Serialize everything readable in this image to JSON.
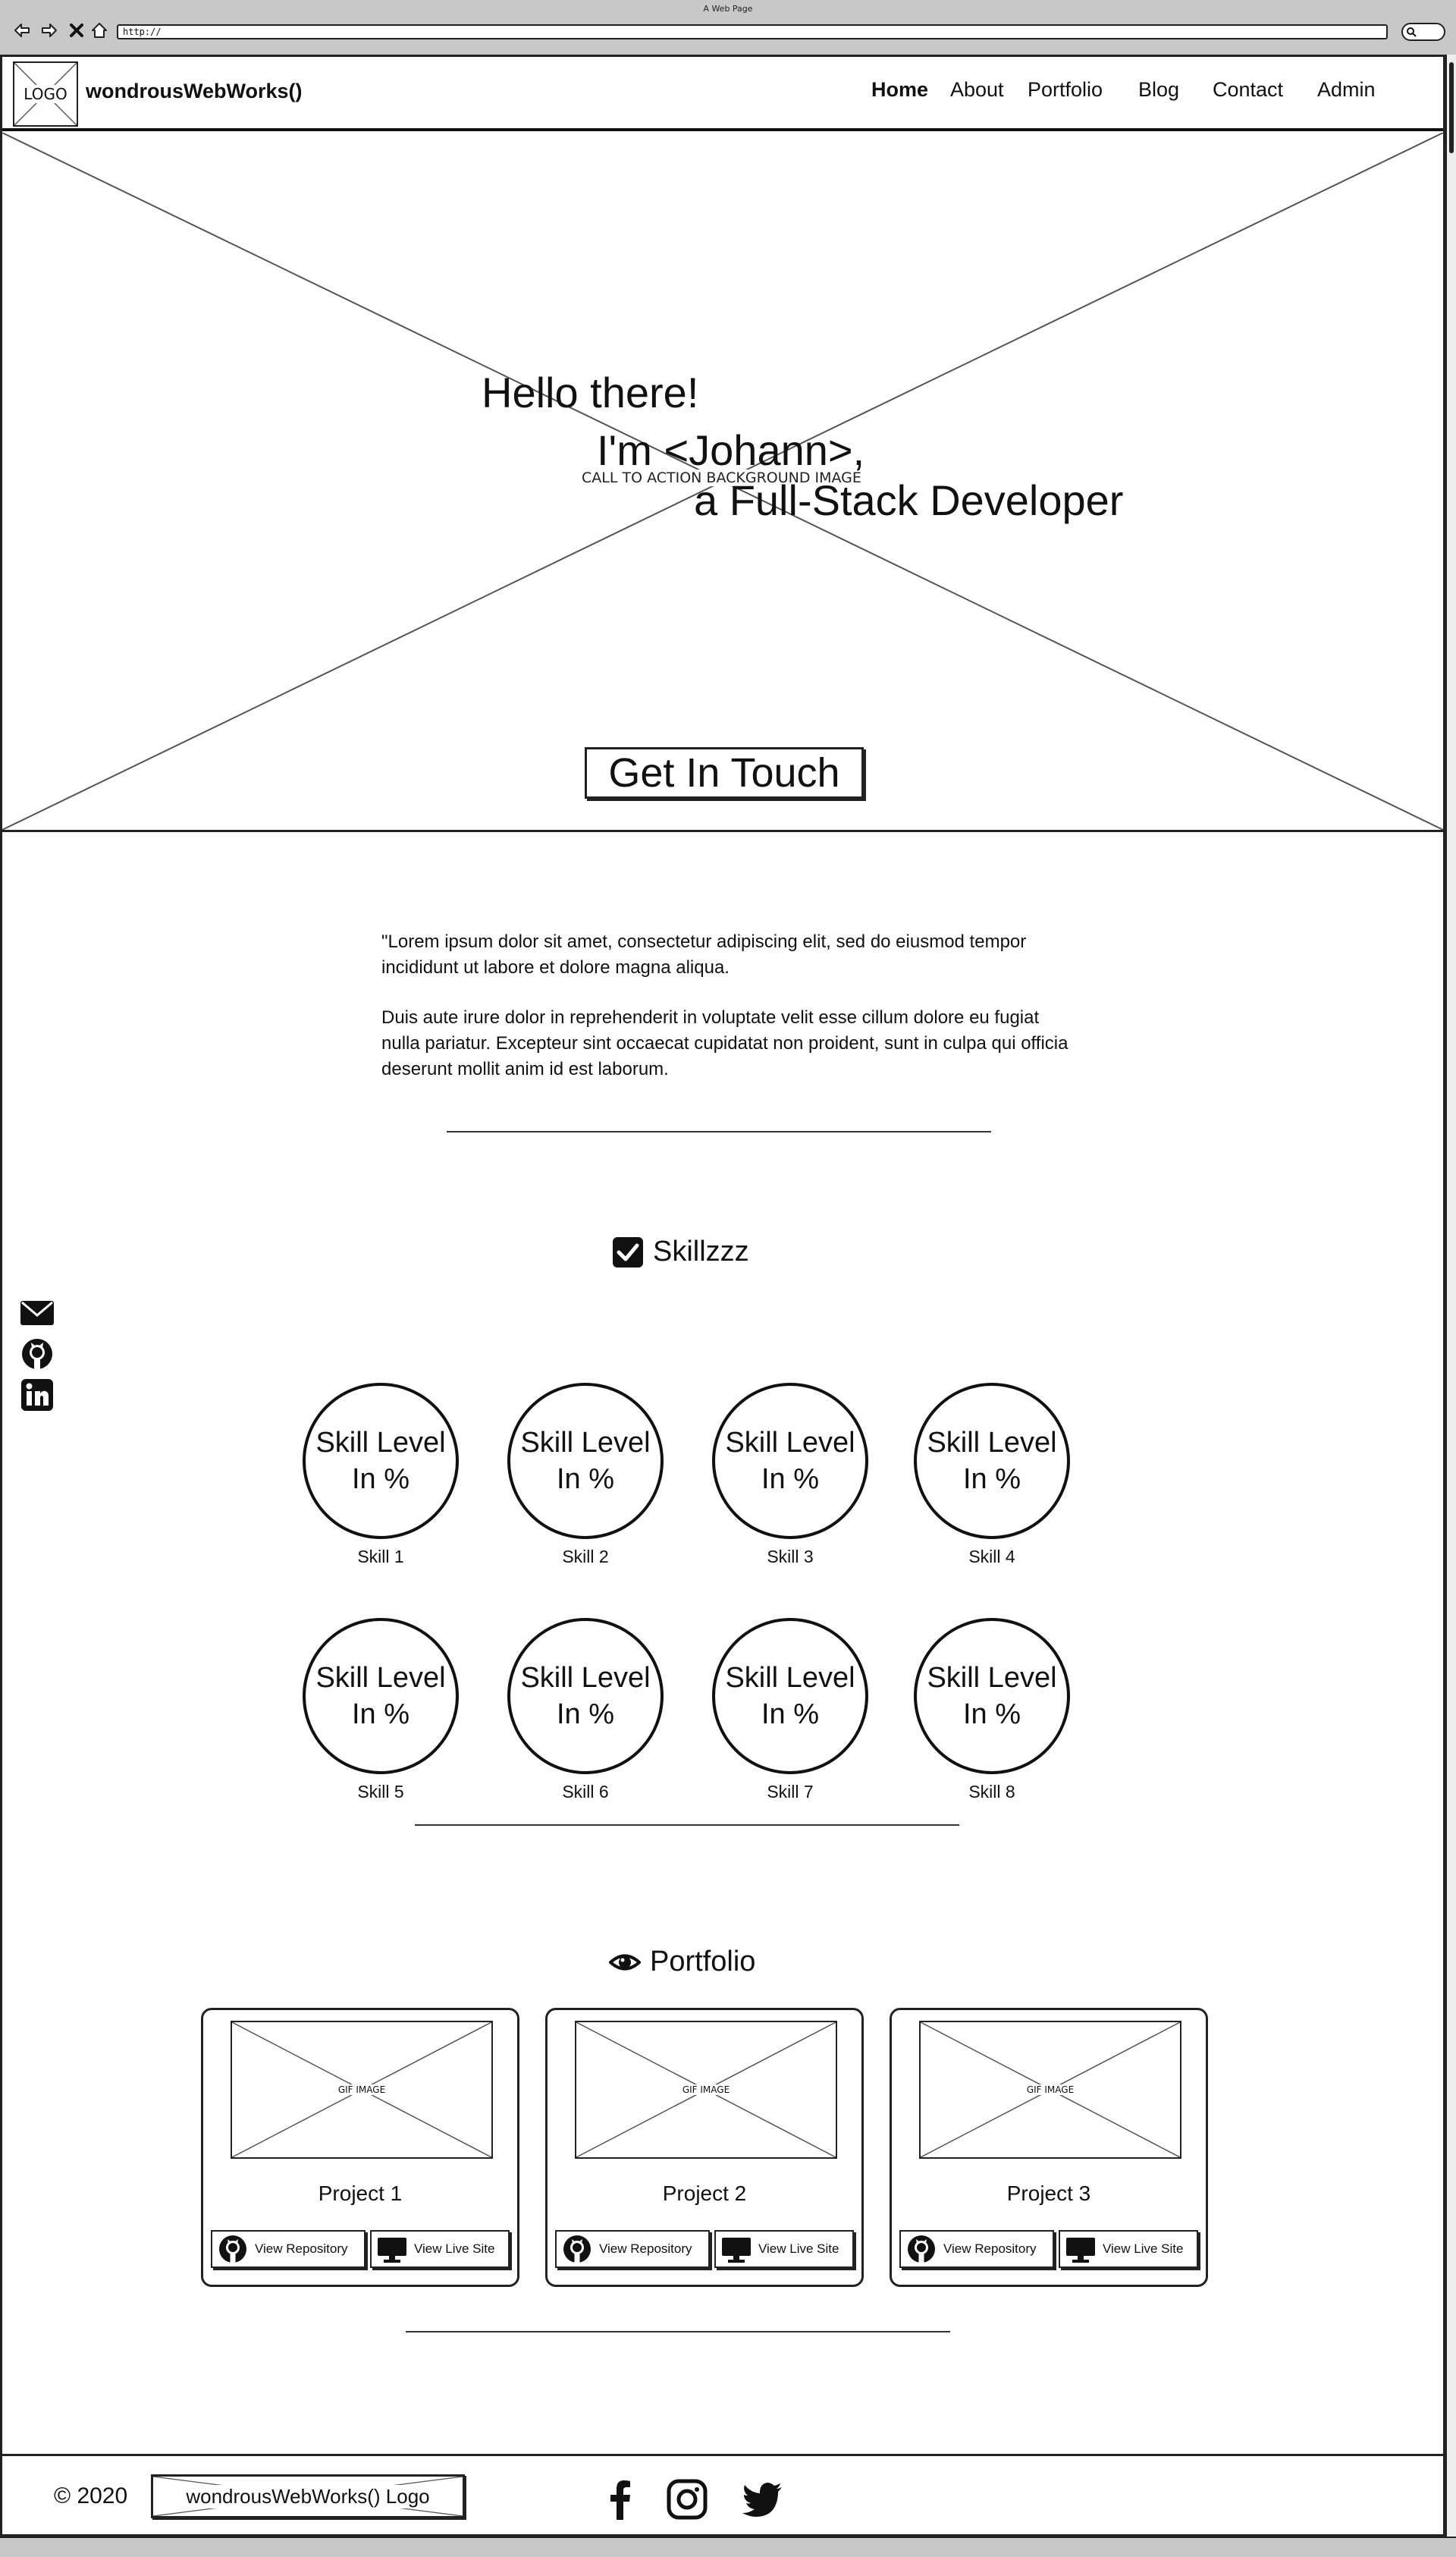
{
  "browser": {
    "window_title": "A Web Page",
    "url": "http://"
  },
  "header": {
    "logo_label": "LOGO",
    "brand": "wondrousWebWorks()",
    "nav": [
      {
        "label": "Home",
        "active": true
      },
      {
        "label": "About",
        "active": false
      },
      {
        "label": "Portfolio",
        "active": false
      },
      {
        "label": "Blog",
        "active": false
      },
      {
        "label": "Contact",
        "active": false
      },
      {
        "label": "Admin",
        "active": false
      }
    ]
  },
  "hero": {
    "image_caption": "CALL TO ACTION BACKGROUND IMAGE",
    "hello": "Hello there!",
    "name_line": "I'm <Johann>,",
    "role_line": "a Full-Stack Developer",
    "cta_label": "Get In Touch"
  },
  "about": {
    "paragraph_1": "\"Lorem ipsum dolor sit amet, consectetur adipiscing elit, sed do eiusmod tempor incididunt ut labore et dolore magna aliqua.",
    "paragraph_2": "Duis aute irure dolor in reprehenderit in voluptate velit esse cillum dolore eu fugiat nulla pariatur. Excepteur sint occaecat cupidatat non proident, sunt in culpa qui officia deserunt mollit anim id est laborum."
  },
  "social_sidebar": [
    "envelope-icon",
    "github-icon",
    "linkedin-icon"
  ],
  "skills": {
    "title": "Skillzzz",
    "icon": "checkbox-checked-icon",
    "items": [
      {
        "circle_line1": "Skill Level",
        "circle_line2": "In %",
        "label": "Skill 1"
      },
      {
        "circle_line1": "Skill Level",
        "circle_line2": "In %",
        "label": "Skill 2"
      },
      {
        "circle_line1": "Skill Level",
        "circle_line2": "In %",
        "label": "Skill 3"
      },
      {
        "circle_line1": "Skill Level",
        "circle_line2": "In %",
        "label": "Skill 4"
      },
      {
        "circle_line1": "Skill Level",
        "circle_line2": "In %",
        "label": "Skill 5"
      },
      {
        "circle_line1": "Skill Level",
        "circle_line2": "In %",
        "label": "Skill 6"
      },
      {
        "circle_line1": "Skill Level",
        "circle_line2": "In %",
        "label": "Skill 7"
      },
      {
        "circle_line1": "Skill Level",
        "circle_line2": "In %",
        "label": "Skill 8"
      }
    ]
  },
  "portfolio": {
    "title": "Portfolio",
    "icon": "eye-icon",
    "projects": [
      {
        "image_caption": "GIF IMAGE",
        "title": "Project 1",
        "repo_label": "View Repository",
        "live_label": "View Live Site"
      },
      {
        "image_caption": "GIF IMAGE",
        "title": "Project 2",
        "repo_label": "View Repository",
        "live_label": "View Live Site"
      },
      {
        "image_caption": "GIF IMAGE",
        "title": "Project 3",
        "repo_label": "View Repository",
        "live_label": "View Live Site"
      }
    ]
  },
  "footer": {
    "copyright": "© 2020",
    "logo_label": "wondrousWebWorks() Logo",
    "social": [
      "facebook-icon",
      "instagram-icon",
      "twitter-icon"
    ]
  }
}
